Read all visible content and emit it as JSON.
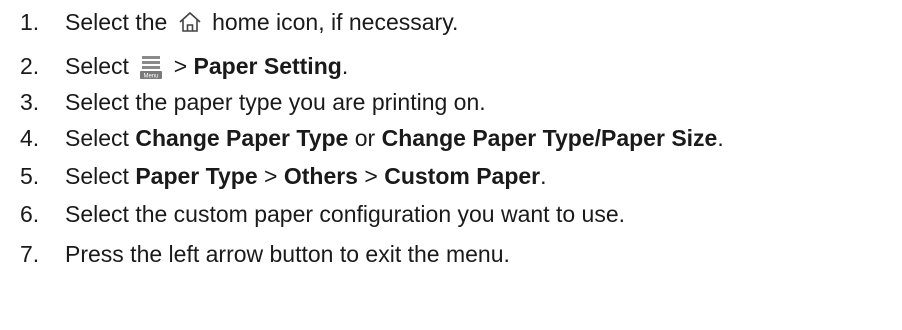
{
  "steps": [
    {
      "number": "1.",
      "parts": [
        {
          "text": "Select the ",
          "bold": false
        },
        {
          "icon": "home-icon"
        },
        {
          "text": " home icon, if necessary.",
          "bold": false
        }
      ]
    },
    {
      "number": "2.",
      "parts": [
        {
          "text": "Select ",
          "bold": false
        },
        {
          "icon": "menu-icon"
        },
        {
          "text": " > ",
          "bold": false
        },
        {
          "text": "Paper Setting",
          "bold": true
        },
        {
          "text": ".",
          "bold": false
        }
      ]
    },
    {
      "number": "3.",
      "parts": [
        {
          "text": "Select the paper type you are printing on.",
          "bold": false
        }
      ]
    },
    {
      "number": "4.",
      "parts": [
        {
          "text": "Select ",
          "bold": false
        },
        {
          "text": "Change Paper Type",
          "bold": true
        },
        {
          "text": " or ",
          "bold": false
        },
        {
          "text": "Change Paper Type/Paper Size",
          "bold": true
        },
        {
          "text": ".",
          "bold": false
        }
      ]
    },
    {
      "number": "5.",
      "parts": [
        {
          "text": "Select ",
          "bold": false
        },
        {
          "text": "Paper Type",
          "bold": true
        },
        {
          "text": " > ",
          "bold": false
        },
        {
          "text": "Others",
          "bold": true
        },
        {
          "text": " > ",
          "bold": false
        },
        {
          "text": "Custom Paper",
          "bold": true
        },
        {
          "text": ".",
          "bold": false
        }
      ]
    },
    {
      "number": "6.",
      "parts": [
        {
          "text": "Select the custom paper configuration you want to use.",
          "bold": false
        }
      ]
    },
    {
      "number": "7.",
      "parts": [
        {
          "text": "Press the left arrow button to exit the menu.",
          "bold": false
        }
      ]
    }
  ],
  "menu_icon_label": "Menu"
}
